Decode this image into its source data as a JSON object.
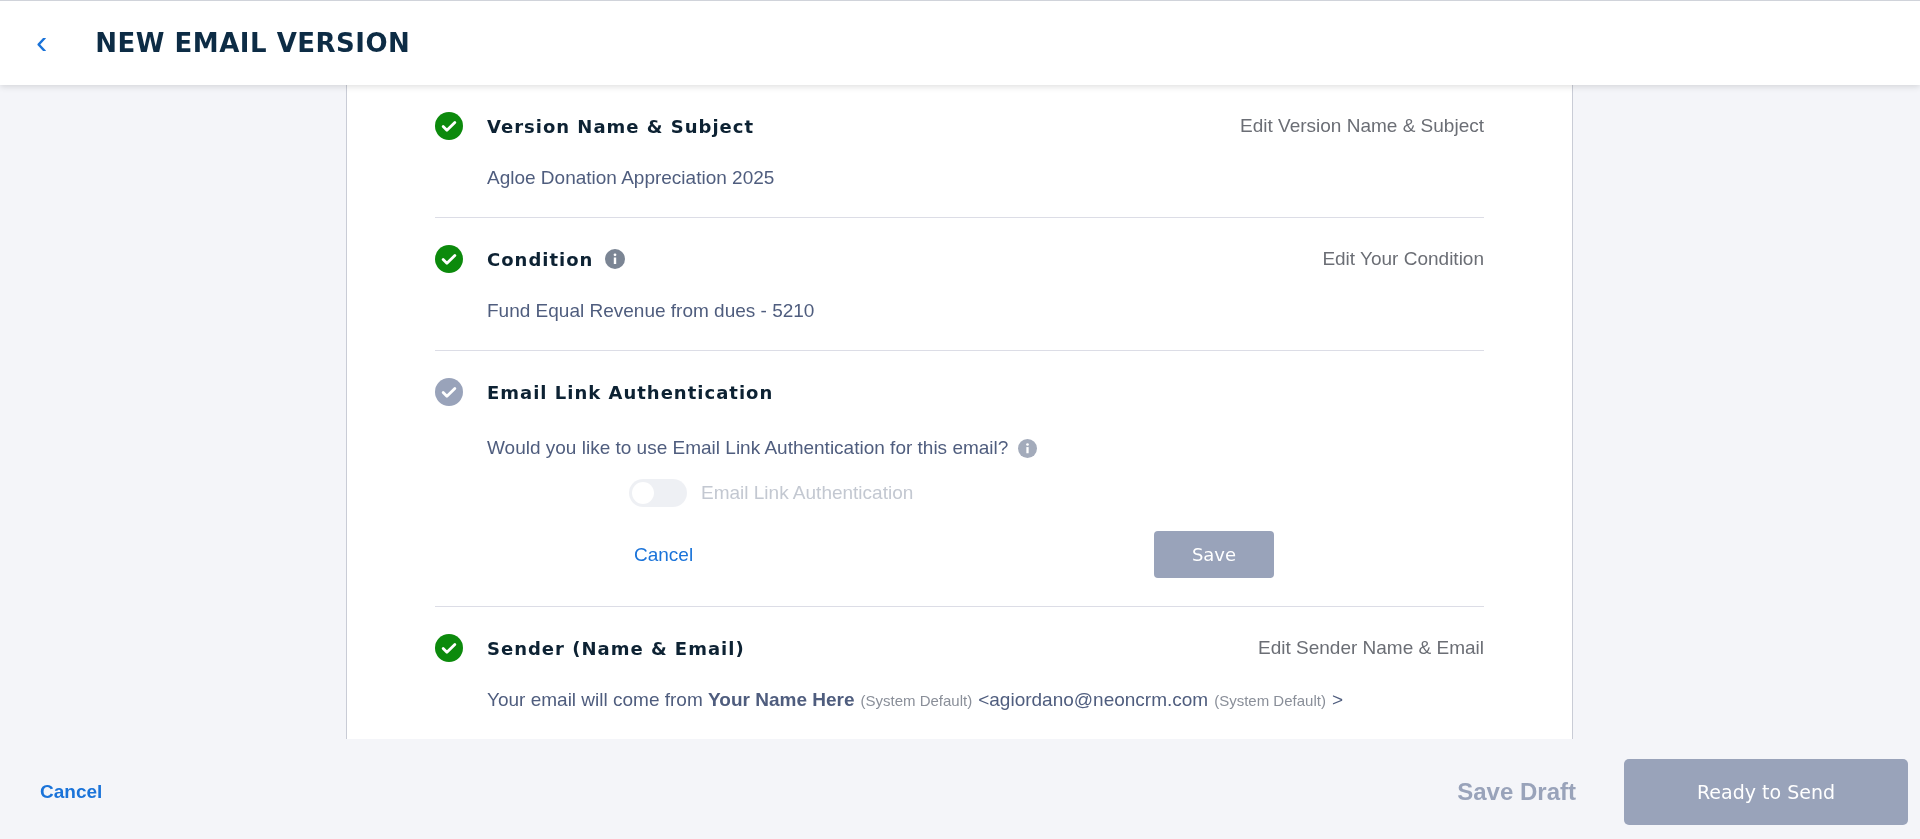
{
  "header": {
    "back_icon": "‹",
    "title": "NEW EMAIL VERSION"
  },
  "sections": [
    {
      "kind": "summary",
      "title": "Version Name & Subject",
      "complete": true,
      "info": false,
      "edit_link": "Edit Version Name & Subject",
      "body": [
        {
          "kind": "plain",
          "text": "Agloe Donation Appreciation 2025"
        }
      ]
    },
    {
      "kind": "summary",
      "title": "Condition",
      "complete": true,
      "info": true,
      "edit_link": "Edit Your Condition",
      "body": [
        {
          "kind": "plain",
          "text": "Fund Equal Revenue from dues - 5210"
        }
      ]
    },
    {
      "kind": "form",
      "title": "Email Link Authentication",
      "complete": false,
      "info": false,
      "question": "Would you like to use Email Link Authentication for this email?",
      "question_info": true,
      "toggle": {
        "label": "Email Link Authentication",
        "on": false,
        "disabled": true
      },
      "cancel": "Cancel",
      "save": {
        "label": "Save",
        "disabled": true
      }
    },
    {
      "kind": "summary",
      "title": "Sender (Name & Email)",
      "complete": true,
      "info": false,
      "edit_link": "Edit Sender Name & Email",
      "body": [
        {
          "kind": "plain",
          "text": "Your email will come from "
        },
        {
          "kind": "strong",
          "text": "Your Name Here"
        },
        {
          "kind": "note",
          "text": "(System Default)"
        },
        {
          "kind": "plain",
          "text": "<agiordano@neoncrm.com"
        },
        {
          "kind": "note",
          "text": "(System Default)"
        },
        {
          "kind": "plain",
          "text": ">"
        }
      ]
    }
  ],
  "footer": {
    "cancel": "Cancel",
    "save_draft": {
      "label": "Save Draft",
      "disabled": true
    },
    "ready": {
      "label": "Ready to Send",
      "disabled": true
    }
  }
}
